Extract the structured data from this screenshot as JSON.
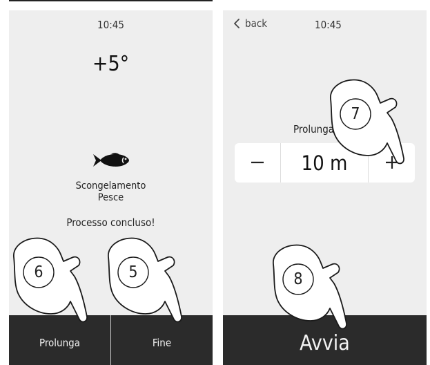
{
  "left_screen": {
    "time": "10:45",
    "temperature": "+5°",
    "program_icon": "fish-icon",
    "program_name_line1": "Scongelamento",
    "program_name_line2": "Pesce",
    "status": "Processo concluso!",
    "buttons": {
      "extend": "Prolunga",
      "finish": "Fine"
    }
  },
  "right_screen": {
    "back_label": "back",
    "time": "10:45",
    "extend_label": "Prolunga",
    "stepper": {
      "value": "10 m",
      "minus": "−",
      "plus": "+"
    },
    "start_button": "Avvia"
  },
  "callouts": {
    "c6": "6",
    "c5": "5",
    "c7": "7",
    "c8": "8"
  },
  "colors": {
    "screen_bg": "#eeeeee",
    "bar_bg": "#2b2b2b",
    "bar_text": "#f2f2f2",
    "stepper_bg": "#ffffff"
  }
}
